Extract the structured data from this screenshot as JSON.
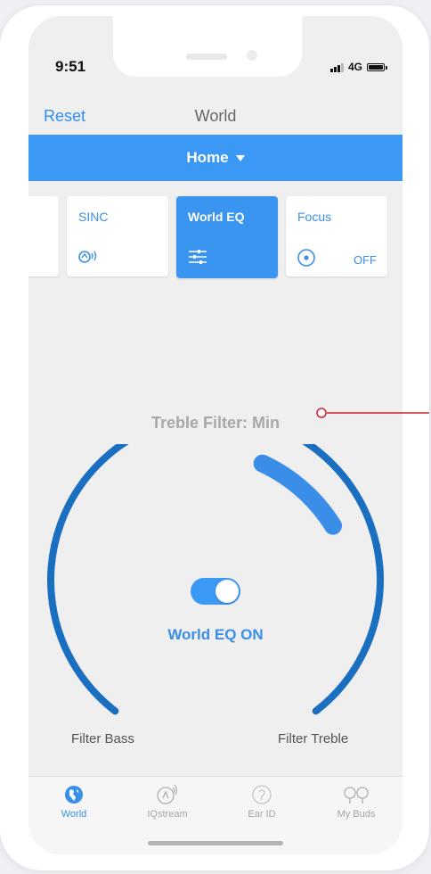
{
  "status_bar": {
    "time": "9:51",
    "network": "4G"
  },
  "nav": {
    "reset_label": "Reset",
    "title": "World"
  },
  "location": {
    "selected": "Home"
  },
  "modes": [
    {
      "label": "",
      "icon": "partial-card"
    },
    {
      "label": "SINC",
      "icon": "sinc-icon"
    },
    {
      "label": "World EQ",
      "icon": "sliders-icon",
      "active": true
    },
    {
      "label": "Focus",
      "icon": "focus-icon",
      "status": "OFF"
    }
  ],
  "eq": {
    "filter_label": "Treble Filter: Min",
    "toggle_on": true,
    "status": "World EQ ON",
    "left_label": "Filter Bass",
    "right_label": "Filter Treble",
    "level_fraction": 0.2
  },
  "tabs": [
    {
      "label": "World",
      "icon": "globe-icon",
      "active": true
    },
    {
      "label": "IQstream",
      "icon": "iqstream-icon"
    },
    {
      "label": "Ear ID",
      "icon": "ear-id-icon"
    },
    {
      "label": "My Buds",
      "icon": "buds-icon"
    }
  ],
  "colors": {
    "accent": "#3b99f5",
    "dial_track": "#1a6fc0",
    "dial_active": "#3a8ee8",
    "callout": "#d0202e"
  }
}
